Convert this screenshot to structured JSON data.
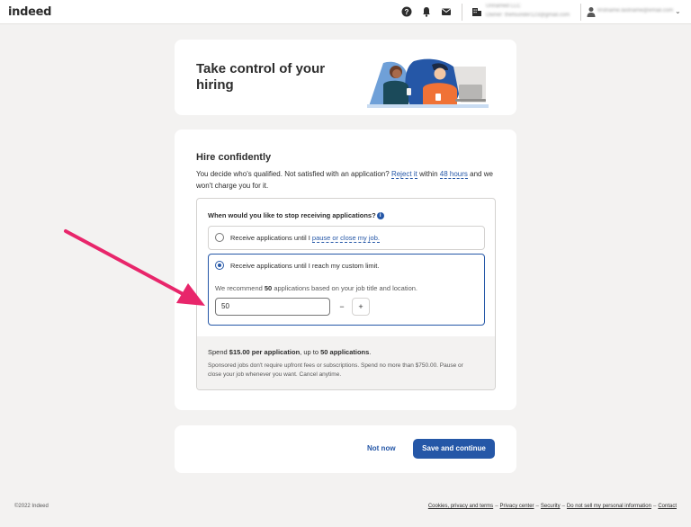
{
  "header": {
    "logo": "indeed",
    "company_name": "Unnamed LLC",
    "company_owner": "Owner: thefounder123@gmail.com",
    "account_name": "firstname.lastname@email.com",
    "chevron": "⌄",
    "icons": [
      "help-icon",
      "bell-icon",
      "mail-icon",
      "company-icon",
      "avatar-icon"
    ]
  },
  "hero": {
    "title": "Take control of your hiring"
  },
  "hire": {
    "title": "Hire confidently",
    "text_before": "You decide who's qualified. Not satisfied with an application?",
    "reject_link": "Reject it",
    "text_mid": "within",
    "hours_link": "48 hours",
    "text_after": "and we won't charge you for it.",
    "question": "When would you like to stop receiving applications?",
    "option1_text": "Receive applications until I",
    "option1_link": "pause or close my job.",
    "option2_text": "Receive applications until I reach my custom limit.",
    "recommend_before": "We recommend",
    "recommend_count": "50",
    "recommend_after": "applications based on your job title and location.",
    "limit_value": "50",
    "minus": "−",
    "plus": "+",
    "spend_before": "Spend",
    "spend_price": "$15.00 per application",
    "spend_mid": ", up to",
    "spend_limit": "50 applications",
    "spend_end": ".",
    "spend_note": "Sponsored jobs don't require upfront fees or subscriptions. Spend no more than $750.00. Pause or close your job whenever you want. Cancel anytime."
  },
  "actions": {
    "not_now": "Not now",
    "save": "Save and continue"
  },
  "footer": {
    "copyright": "©2022 Indeed",
    "links": [
      "Cookies, privacy and terms",
      "Privacy center",
      "Security",
      "Do not sell my personal information",
      "Contact"
    ],
    "separator": "–"
  },
  "colors": {
    "accent": "#2557a7",
    "arrow": "#e8266b",
    "background": "#f3f2f1"
  }
}
